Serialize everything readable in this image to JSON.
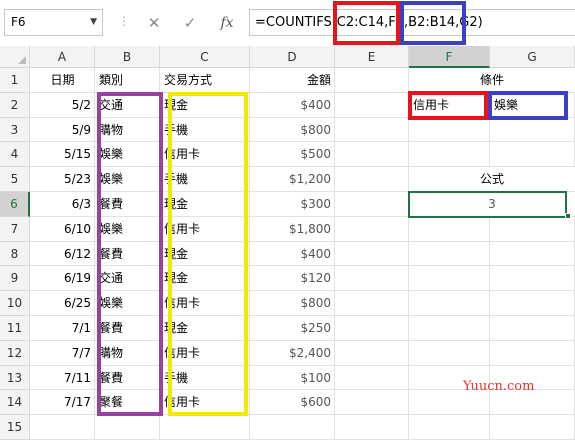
{
  "name_box": "F6",
  "formula": "=COUNTIFS(C2:C14,F2,B2:B14,G2)",
  "columns": [
    "A",
    "B",
    "C",
    "D",
    "E",
    "F",
    "G"
  ],
  "rows": [
    "1",
    "2",
    "3",
    "4",
    "5",
    "6",
    "7",
    "8",
    "9",
    "10",
    "11",
    "12",
    "13",
    "14",
    "15"
  ],
  "headers": {
    "date": "日期",
    "category": "類別",
    "payment": "交易方式",
    "amount": "金額"
  },
  "records": [
    {
      "date": "5/2",
      "category": "交通",
      "payment": "現金",
      "amount": "$400"
    },
    {
      "date": "5/9",
      "category": "購物",
      "payment": "手機",
      "amount": "$800"
    },
    {
      "date": "5/15",
      "category": "娛樂",
      "payment": "信用卡",
      "amount": "$500"
    },
    {
      "date": "5/23",
      "category": "娛樂",
      "payment": "手機",
      "amount": "$1,200"
    },
    {
      "date": "6/3",
      "category": "餐費",
      "payment": "現金",
      "amount": "$300"
    },
    {
      "date": "6/10",
      "category": "娛樂",
      "payment": "信用卡",
      "amount": "$1,800"
    },
    {
      "date": "6/12",
      "category": "餐費",
      "payment": "現金",
      "amount": "$400"
    },
    {
      "date": "6/19",
      "category": "交通",
      "payment": "現金",
      "amount": "$120"
    },
    {
      "date": "6/25",
      "category": "娛樂",
      "payment": "信用卡",
      "amount": "$800"
    },
    {
      "date": "7/1",
      "category": "餐費",
      "payment": "現金",
      "amount": "$250"
    },
    {
      "date": "7/7",
      "category": "購物",
      "payment": "信用卡",
      "amount": "$2,400"
    },
    {
      "date": "7/11",
      "category": "餐費",
      "payment": "手機",
      "amount": "$100"
    },
    {
      "date": "7/17",
      "category": "聚餐",
      "payment": "信用卡",
      "amount": "$600"
    }
  ],
  "criteria": {
    "title": "條件",
    "f2": "信用卡",
    "g2": "娛樂"
  },
  "result": {
    "title": "公式",
    "value": "3"
  },
  "watermark": "Yuucn.com",
  "colors": {
    "red": "#e8141b",
    "blue": "#3c3fc8",
    "purple": "#9a3fa3",
    "yellow": "#f3ea00",
    "green": "#217346"
  }
}
